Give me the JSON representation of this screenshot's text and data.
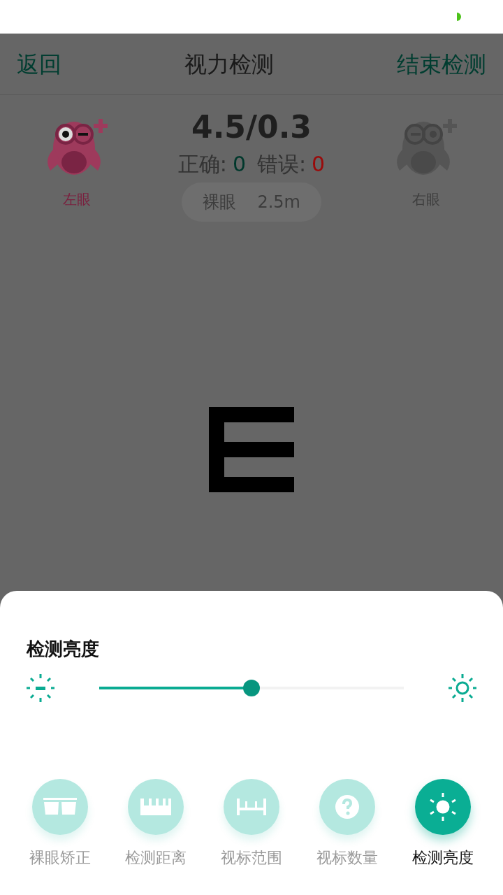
{
  "header": {
    "back": "返回",
    "title": "视力检测",
    "end": "结束检测"
  },
  "eyes": [
    {
      "label": "左眼",
      "selected": true
    },
    {
      "label": "右眼",
      "selected": false
    }
  ],
  "score": "4.5/0.3",
  "counts": [
    {
      "label": "正确:",
      "value": "0",
      "kind": "correct"
    },
    {
      "label": "错误:",
      "value": "0",
      "kind": "wrong"
    }
  ],
  "mode": {
    "name": "裸眼",
    "distance": "2.5m"
  },
  "panel": {
    "title": "检测亮度",
    "level": 0.5
  },
  "tools": [
    {
      "label": "裸眼矫正",
      "kind": "glasses",
      "selected": false
    },
    {
      "label": "检测距离",
      "kind": "ruler",
      "selected": false
    },
    {
      "label": "视标范围",
      "kind": "range",
      "selected": false
    },
    {
      "label": "视标数量",
      "kind": "question",
      "selected": false
    },
    {
      "label": "检测亮度",
      "kind": "brightness",
      "selected": true
    }
  ]
}
